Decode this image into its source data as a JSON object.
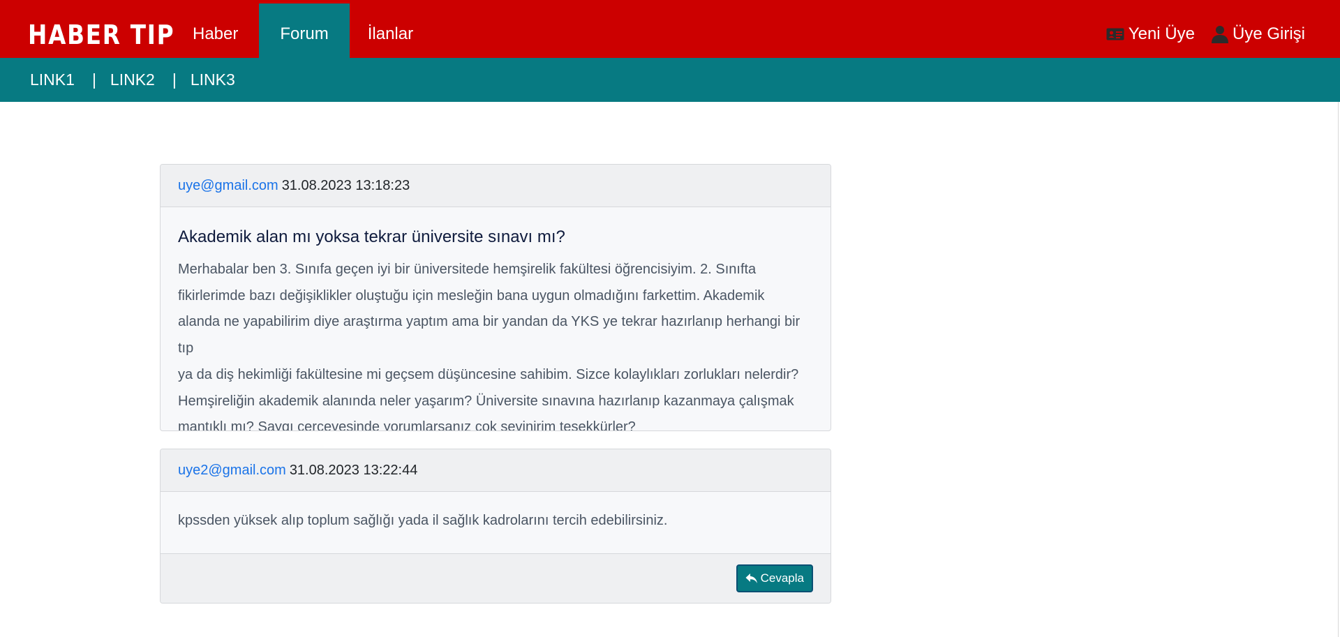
{
  "brand": {
    "logo_text": "HABER TIP"
  },
  "nav": {
    "items": [
      {
        "label": "Haber",
        "active": false
      },
      {
        "label": "Forum",
        "active": true
      },
      {
        "label": "İlanlar",
        "active": false
      }
    ]
  },
  "auth": {
    "register_label": "Yeni Üye",
    "register_icon": "id-card-icon",
    "login_label": "Üye Girişi",
    "login_icon": "user-icon"
  },
  "subnav": {
    "links": [
      "LINK1",
      "LINK2",
      "LINK3"
    ],
    "separator": "|"
  },
  "colors": {
    "topbar": "#cc0000",
    "subbar": "#077a82",
    "link": "#1a73e8"
  },
  "question": {
    "author": "uye@gmail.com",
    "timestamp": "31.08.2023 13:18:23",
    "title": "Akademik alan mı yoksa tekrar üniversite sınavı mı?",
    "lines": [
      "Merhabalar ben 3. Sınıfa geçen iyi bir üniversitede hemşirelik fakültesi öğrencisiyim. 2. Sınıfta",
      "fikirlerimde bazı değişiklikler oluştuğu için mesleğin bana uygun olmadığını farkettim. Akademik",
      "alanda ne yapabilirim diye araştırma yaptım ama bir yandan da YKS ye tekrar hazırlanıp herhangi bir tıp",
      "ya da diş hekimliği fakültesine mi geçsem düşüncesine sahibim. Sizce kolaylıkları zorlukları nelerdir?",
      "Hemşireliğin akademik alanında neler yaşarım? Üniversite sınavına hazırlanıp kazanmaya çalışmak",
      "mantıklı mı? Saygı çerçevesinde yorumlarsanız çok sevinirim teşekkürler?"
    ]
  },
  "reply": {
    "author": "uye2@gmail.com",
    "timestamp": "31.08.2023 13:22:44",
    "text": "kpssden yüksek alıp toplum sağlığı yada il sağlık kadrolarını tercih edebilirsiniz.",
    "button_label": "Cevapla",
    "button_icon": "reply-icon"
  }
}
